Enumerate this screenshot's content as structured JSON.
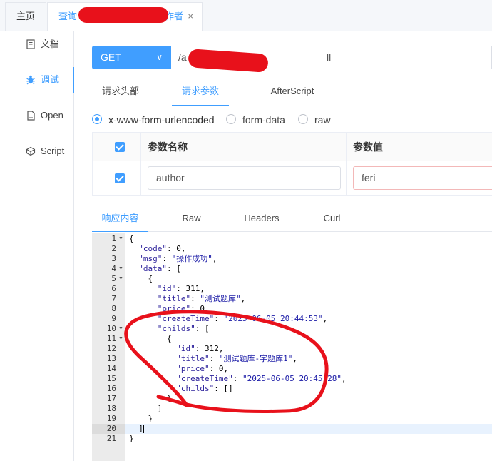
{
  "tabs": {
    "home": "主页",
    "active_prefix": "查询",
    "active_suffix": "作者",
    "close_glyph": "×"
  },
  "sidebar": {
    "items": [
      {
        "label": "文档",
        "icon": "document-icon"
      },
      {
        "label": "调试",
        "icon": "bug-icon",
        "active": true
      },
      {
        "label": "Open",
        "icon": "file-icon"
      },
      {
        "label": "Script",
        "icon": "code-icon"
      }
    ]
  },
  "request": {
    "method": "GET",
    "method_chevron": "∨",
    "url_visible_start": "/a",
    "url_visible_end": "ll"
  },
  "request_tabs": [
    "请求头部",
    "请求参数",
    "AfterScript"
  ],
  "active_request_tab": 1,
  "body_types": [
    "x-www-form-urlencoded",
    "form-data",
    "raw"
  ],
  "active_body_type": 0,
  "params_table": {
    "headers": [
      "参数名称",
      "参数值"
    ],
    "rows": [
      {
        "checked": true,
        "name": "author",
        "value": "feri"
      }
    ]
  },
  "response_tabs": [
    "响应内容",
    "Raw",
    "Headers",
    "Curl"
  ],
  "active_response_tab": 0,
  "response": {
    "line_numbers": [
      "1",
      "2",
      "3",
      "4",
      "5",
      "6",
      "7",
      "8",
      "9",
      "10",
      "11",
      "12",
      "13",
      "14",
      "15",
      "16",
      "17",
      "18",
      "19",
      "20",
      "21"
    ],
    "lines": [
      "{",
      "  \"code\": 0,",
      "  \"msg\": \"操作成功\",",
      "  \"data\": [",
      "    {",
      "      \"id\": 311,",
      "      \"title\": \"测试题库\",",
      "      \"price\": 0,",
      "      \"createTime\": \"2025-06-05 20:44:53\",",
      "      \"childs\": [",
      "        {",
      "          \"id\": 312,",
      "          \"title\": \"测试题库-字题库1\",",
      "          \"price\": 0,",
      "          \"createTime\": \"2025-06-05 20:45:28\",",
      "          \"childs\": []",
      "        }",
      "      ]",
      "    }",
      "  ]",
      "}"
    ],
    "foldable_lines": [
      "1",
      "4",
      "5",
      "10",
      "11"
    ],
    "active_line": "20"
  },
  "colors": {
    "accent": "#409eff",
    "annotation_red": "#e8111b"
  }
}
